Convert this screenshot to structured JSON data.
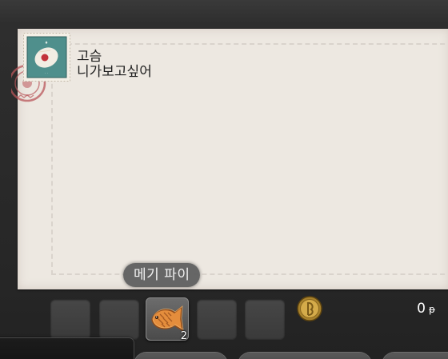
{
  "letter": {
    "line1": "고슴",
    "line2": "니가보고싶어"
  },
  "tooltip": {
    "text": "메기 파이"
  },
  "attachments": {
    "item": {
      "icon": "fish-pie-icon",
      "count": "2"
    }
  },
  "currency": {
    "icon": "gil-coin-icon",
    "amount": "0",
    "unit": "ᵽ"
  },
  "footer": {
    "button1_label": "",
    "button2_label": ""
  }
}
